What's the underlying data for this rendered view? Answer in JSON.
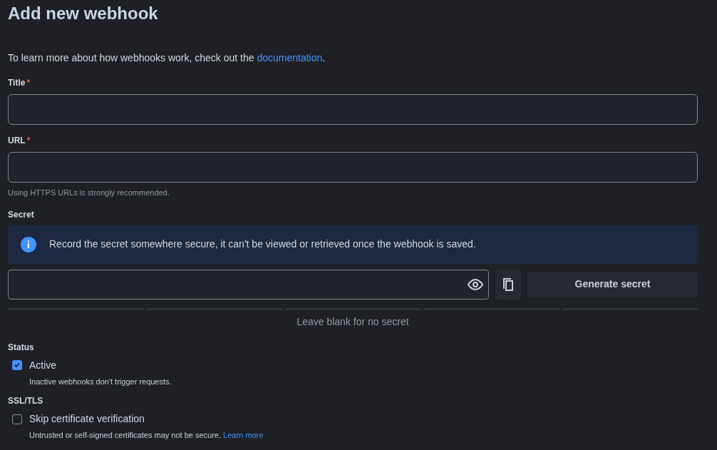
{
  "heading": "Add new webhook",
  "intro": {
    "text": "To learn more about how webhooks work, check out the ",
    "link": "documentation",
    "after": "."
  },
  "fields": [
    {
      "label": "Title",
      "required_mark": "*"
    },
    {
      "label": "URL",
      "required_mark": "*",
      "hint": "Using HTTPS URLs is strongly recommended."
    }
  ],
  "secret": {
    "label": "Secret",
    "notice": "Record the secret somewhere secure, it can't be viewed or retrieved once the webhook is saved.",
    "generate_button": "Generate secret",
    "strength": {
      "hint": "Leave blank for no secret"
    }
  },
  "status": {
    "label": "Status",
    "checkbox": {
      "label": "Active",
      "checked": true,
      "hint": "Inactive webhooks don't trigger requests."
    }
  },
  "ssl": {
    "label": "SSL/TLS",
    "checkbox": {
      "label": "Skip certificate verification",
      "checked": false,
      "hint": "Untrusted or self-signed certificates may not be secure. ",
      "link": "Learn more"
    }
  }
}
